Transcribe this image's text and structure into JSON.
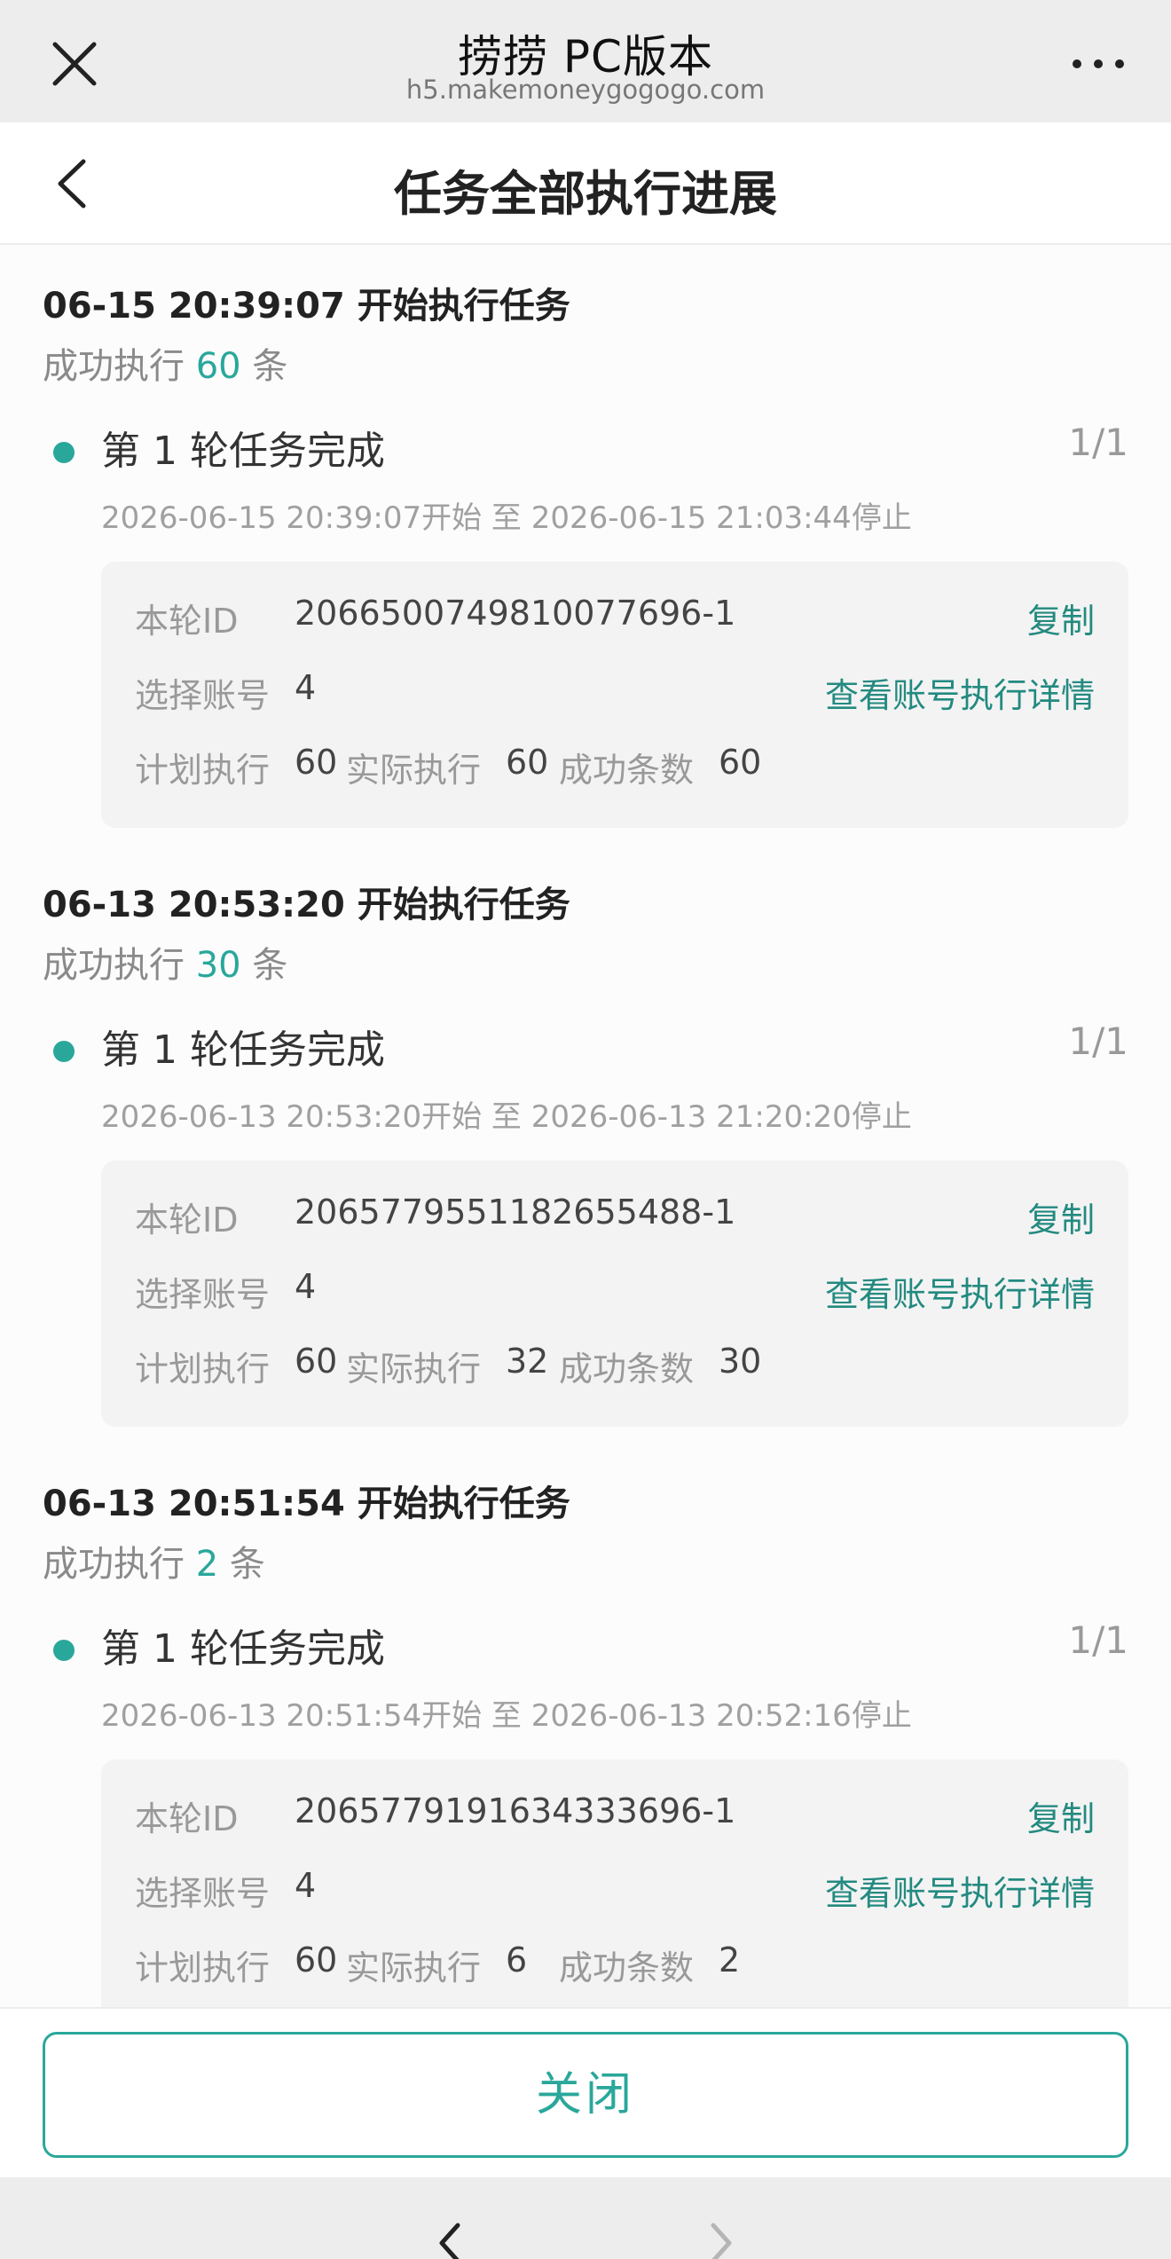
{
  "browser": {
    "title": "捞捞 PC版本",
    "url": "h5.makemoneygogogo.com"
  },
  "page": {
    "title": "任务全部执行进展"
  },
  "tasks": [
    {
      "header": "06-15 20:39:07 开始执行任务",
      "summary_prefix": "成功执行 ",
      "success_count": "60",
      "summary_suffix": " 条",
      "round_title": "第 1 轮任务完成",
      "round_count": "1/1",
      "round_time": "2026-06-15 20:39:07开始 至 2026-06-15 21:03:44停止",
      "round_id_label": "本轮ID",
      "round_id": "2066500749810077696-1",
      "copy_label": "复制",
      "accounts_label": "选择账号",
      "accounts": "4",
      "details_link": "查看账号执行详情",
      "planned_label": "计划执行",
      "planned": "60",
      "actual_label": "实际执行",
      "actual": "60",
      "success_label": "成功条数",
      "success": "60"
    },
    {
      "header": "06-13 20:53:20 开始执行任务",
      "summary_prefix": "成功执行 ",
      "success_count": "30",
      "summary_suffix": " 条",
      "round_title": "第 1 轮任务完成",
      "round_count": "1/1",
      "round_time": "2026-06-13 20:53:20开始 至 2026-06-13 21:20:20停止",
      "round_id_label": "本轮ID",
      "round_id": "2065779551182655488-1",
      "copy_label": "复制",
      "accounts_label": "选择账号",
      "accounts": "4",
      "details_link": "查看账号执行详情",
      "planned_label": "计划执行",
      "planned": "60",
      "actual_label": "实际执行",
      "actual": "32",
      "success_label": "成功条数",
      "success": "30"
    },
    {
      "header": "06-13 20:51:54 开始执行任务",
      "summary_prefix": "成功执行 ",
      "success_count": "2",
      "summary_suffix": " 条",
      "round_title": "第 1 轮任务完成",
      "round_count": "1/1",
      "round_time": "2026-06-13 20:51:54开始 至 2026-06-13 20:52:16停止",
      "round_id_label": "本轮ID",
      "round_id": "2065779191634333696-1",
      "copy_label": "复制",
      "accounts_label": "选择账号",
      "accounts": "4",
      "details_link": "查看账号执行详情",
      "planned_label": "计划执行",
      "planned": "60",
      "actual_label": "实际执行",
      "actual": "6",
      "success_label": "成功条数",
      "success": "2"
    }
  ],
  "footer": {
    "close_label": "关闭"
  },
  "icons": {
    "browser_close": "close-icon",
    "browser_more": "more-icon",
    "page_back": "chevron-left-icon",
    "nav_back": "chevron-left-icon",
    "nav_forward": "chevron-right-icon"
  },
  "colors": {
    "accent": "#2aa79b",
    "link": "#238a80"
  }
}
